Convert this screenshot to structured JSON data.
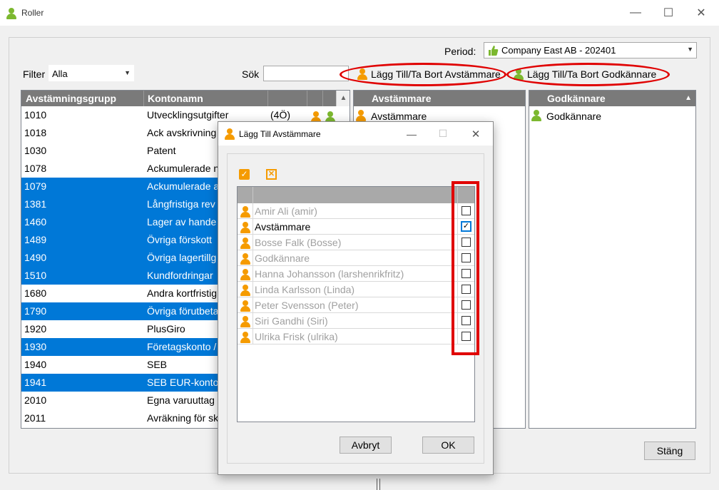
{
  "window": {
    "title": "Roller"
  },
  "filter": {
    "label": "Filter",
    "value": "Alla"
  },
  "search": {
    "label": "Sök",
    "value": ""
  },
  "period": {
    "label": "Period:",
    "value": "Company East AB - 202401"
  },
  "actions": {
    "add_remove_reconciler": "Lägg Till/Ta Bort Avstämmare",
    "add_remove_approver": "Lägg Till/Ta Bort Godkännare"
  },
  "main_table": {
    "columns": [
      "Avstämningsgrupp",
      "Kontonamn"
    ],
    "rows": [
      {
        "group": "1010",
        "name": "Utvecklingsutgifter",
        "extra": "(4Ö)",
        "selected": false,
        "icons": true
      },
      {
        "group": "1018",
        "name": "Ack avskrivning",
        "extra": "",
        "selected": false,
        "icons": false
      },
      {
        "group": "1030",
        "name": "Patent",
        "extra": "",
        "selected": false,
        "icons": false
      },
      {
        "group": "1078",
        "name": "Ackumulerade n",
        "extra": "",
        "selected": false,
        "icons": false
      },
      {
        "group": "1079",
        "name": "Ackumulerade a",
        "extra": "",
        "selected": true,
        "icons": false
      },
      {
        "group": "1381",
        "name": "Långfristiga rev",
        "extra": "",
        "selected": true,
        "icons": false
      },
      {
        "group": "1460",
        "name": "Lager av hande",
        "extra": "",
        "selected": true,
        "icons": false
      },
      {
        "group": "1489",
        "name": "Övriga förskott",
        "extra": "",
        "selected": true,
        "icons": false
      },
      {
        "group": "1490",
        "name": "Övriga lagertillg",
        "extra": "",
        "selected": true,
        "icons": false
      },
      {
        "group": "1510",
        "name": "Kundfordringar",
        "extra": "",
        "selected": true,
        "icons": false
      },
      {
        "group": "1680",
        "name": "Andra kortfristig",
        "extra": "",
        "selected": false,
        "icons": false
      },
      {
        "group": "1790",
        "name": "Övriga förutbeta",
        "extra": "",
        "selected": true,
        "icons": false
      },
      {
        "group": "1920",
        "name": "PlusGiro",
        "extra": "",
        "selected": false,
        "icons": false
      },
      {
        "group": "1930",
        "name": "Företagskonto /",
        "extra": "",
        "selected": true,
        "icons": false
      },
      {
        "group": "1940",
        "name": "SEB",
        "extra": "",
        "selected": false,
        "icons": false
      },
      {
        "group": "1941",
        "name": "SEB EUR-konto",
        "extra": "",
        "selected": true,
        "icons": false
      },
      {
        "group": "2010",
        "name": "Egna varuuttag",
        "extra": "",
        "selected": false,
        "icons": false
      },
      {
        "group": "2011",
        "name": "Avräkning för sk",
        "extra": "",
        "selected": false,
        "icons": false
      }
    ]
  },
  "reconcilers_panel": {
    "header": "Avstämmare",
    "items": [
      "Avstämmare"
    ]
  },
  "approvers_panel": {
    "header": "Godkännare",
    "items": [
      "Godkännare"
    ]
  },
  "close_button": "Stäng",
  "dialog": {
    "title": "Lägg Till Avstämmare",
    "items": [
      {
        "name": "Amir Ali (amir)",
        "checked": false,
        "active": false,
        "group": false
      },
      {
        "name": "Avstämmare",
        "checked": true,
        "active": true,
        "group": true
      },
      {
        "name": "Bosse Falk (Bosse)",
        "checked": false,
        "active": false,
        "group": false
      },
      {
        "name": "Godkännare",
        "checked": false,
        "active": false,
        "group": true
      },
      {
        "name": "Hanna Johansson (larshenrikfritz)",
        "checked": false,
        "active": false,
        "group": false
      },
      {
        "name": "Linda Karlsson (Linda)",
        "checked": false,
        "active": false,
        "group": false
      },
      {
        "name": "Peter Svensson (Peter)",
        "checked": false,
        "active": false,
        "group": false
      },
      {
        "name": "Siri Gandhi (Siri)",
        "checked": false,
        "active": false,
        "group": false
      },
      {
        "name": "Ulrika Frisk (ulrika)",
        "checked": false,
        "active": false,
        "group": false
      }
    ],
    "cancel_label": "Avbryt",
    "ok_label": "OK"
  },
  "colors": {
    "selection": "#0078d7",
    "highlight": "#e00000",
    "user_icon": "#f59b00",
    "approver_icon": "#7cb82f",
    "header": "#7a7a7a"
  }
}
